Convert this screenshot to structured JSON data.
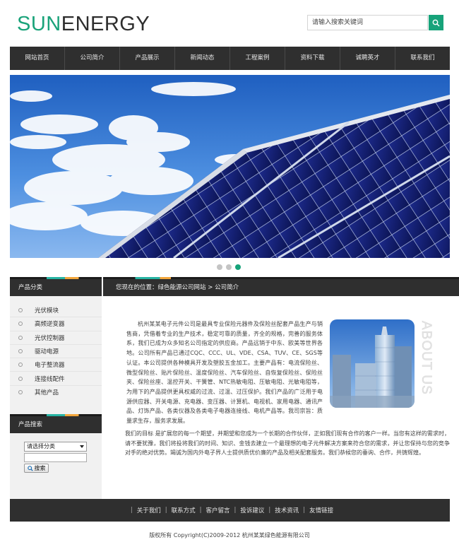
{
  "header": {
    "logo_part1": "SUN",
    "logo_part2": "ENERGY",
    "search_placeholder": "请输入搜索关键词"
  },
  "nav": [
    "网站首页",
    "公司简介",
    "产品展示",
    "新闻动态",
    "工程案例",
    "资料下载",
    "诚聘英才",
    "联系我们"
  ],
  "sidebar": {
    "category_title": "产品分类",
    "categories": [
      "光伏模块",
      "高频逆变器",
      "光伏控制器",
      "驱动电源",
      "电子整流器",
      "连接线配件",
      "其他产品"
    ],
    "search_title": "产品搜索",
    "select_value": "请选择分类",
    "search_button": "搜索"
  },
  "breadcrumb": {
    "prefix": "您现在的位置：",
    "site": "绿色能源公司网站",
    "separator": " > ",
    "current": "公司简介"
  },
  "about": {
    "vertical_label": "ABOUT US",
    "paragraph1": "杭州某某电子元件公司是最具专业保险元器件及保险丝配套产品生产与销售商，凭借着专业的生产技术，稳定可靠的质量，齐全的规格，完善的服务体系，我们已成为众多知名公司指定的供应商。产品远销于中东、欧美等世界各地。公司所有产品已通过CQC、CCC、UL、VDE、CSA、TUV、CE、SGS等认证。本公司提供各种模具开发及塑胶五金加工。主要产品有：电流保险丝、微型保险丝、贴片保险丝、温度保险丝、汽车保险丝、自恢复保险丝、保险丝夹、保险丝座、温控开关、干簧管、NTC热敏电阻、压敏电阻、光敏电阻等，为用下的产品提供更具权威的过流、过温、过压保护。我们产品的广泛用于电源供应器、开关电源、充电器、变压器、计算机、电视机、家用电器、通讯产品、灯饰产品、各类仪器及各类电子电器连接线、电机产品等。我司宗旨：质量求生存，服务求发展。",
    "paragraph2": "我们的目标 是扩展您的每一个期望，并期望和您成为一个长期的合作伙伴，正如我们现有合作的客户一样。当您有这样的需求时，请不要犹豫，我们将投将我们的时间、知识、金钱去建立一个最理想的电子元件解决方案来符合您的需求，并让您保持与您的竞争对手的绝对优势。竭诚为国内外电子界人士提供质优价廉的产品及相关配套服务。我们恭候您的垂询、合作，共铸辉煌。"
  },
  "footer": {
    "links": [
      "关于我们",
      "联系方式",
      "客户留言",
      "投诉建议",
      "技术资讯",
      "友情链接"
    ],
    "copyright": "版权所有  Copyright(C)2009-2012 杭州某某绿色能源有限公司"
  },
  "colors": {
    "accent": "#17a37a",
    "dark_bar": "#2f2f2f"
  }
}
